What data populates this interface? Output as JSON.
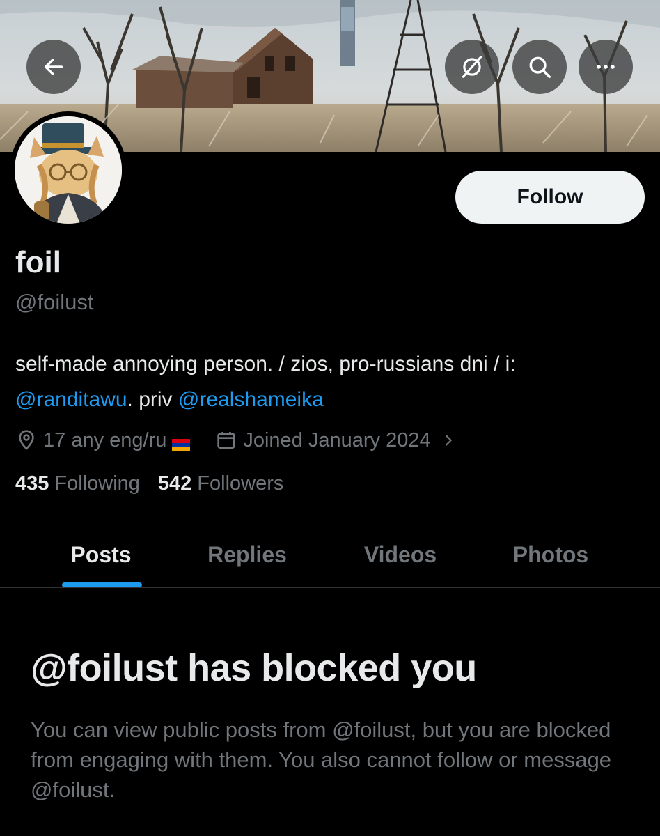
{
  "header": {
    "back_icon": "arrow-left-icon",
    "share_icon": "share-off-icon",
    "search_icon": "search-icon",
    "more_icon": "more-horizontal-icon"
  },
  "profile": {
    "display_name": "foil",
    "handle": "@foilust",
    "follow_label": "Follow",
    "bio": {
      "line1": "self-made annoying person. / zios, pro-russians dni / i:",
      "mention1": "@randitawu",
      "priv_text": ". priv ",
      "mention2": "@realshameika"
    },
    "location": "17 any eng/ru",
    "location_flag": "armenia-flag",
    "joined": "Joined January 2024",
    "following_count": "435",
    "following_label": "Following",
    "followers_count": "542",
    "followers_label": "Followers"
  },
  "tabs": [
    {
      "label": "Posts",
      "active": true
    },
    {
      "label": "Replies",
      "active": false
    },
    {
      "label": "Videos",
      "active": false
    },
    {
      "label": "Photos",
      "active": false
    }
  ],
  "blocked": {
    "title": "@foilust has blocked you",
    "description": "You can view public posts from @foilust, but you are blocked from engaging with them. You also cannot follow or message @foilust."
  },
  "colors": {
    "background": "#000000",
    "accent": "#1d9bf0",
    "text_primary": "#e7e9ea",
    "text_secondary": "#71767b",
    "follow_bg": "#eff3f4"
  }
}
